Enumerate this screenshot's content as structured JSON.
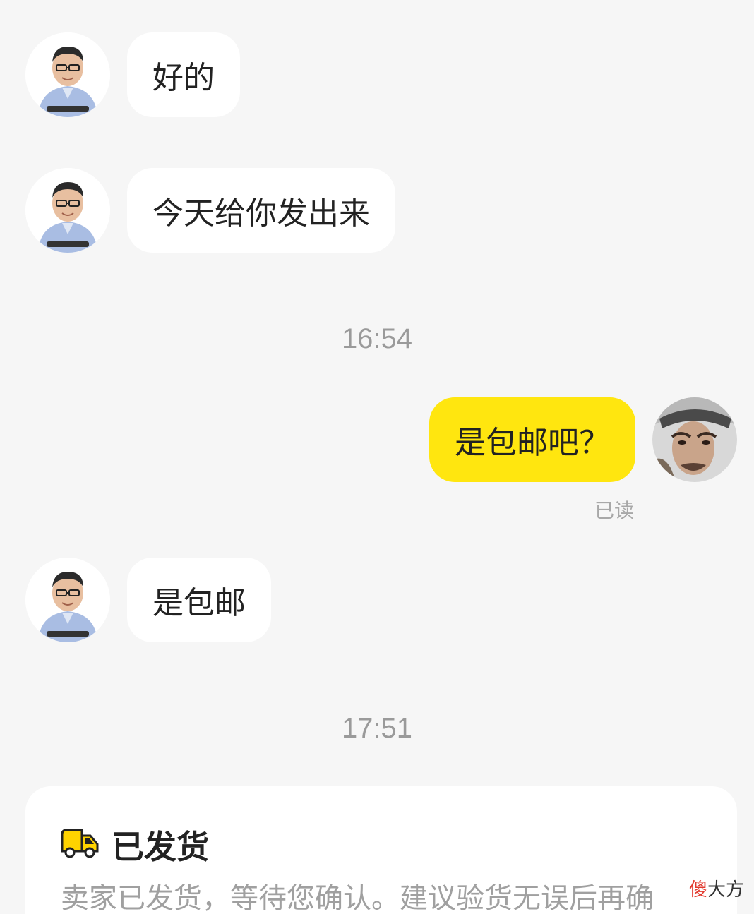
{
  "messages": [
    {
      "side": "left",
      "text": "好的",
      "avatar": "seller-avatar"
    },
    {
      "side": "left",
      "text": "今天给你发出来",
      "avatar": "seller-avatar"
    },
    {
      "side": "right",
      "text": "是包邮吧？",
      "avatar": "buyer-avatar",
      "status": "已读"
    },
    {
      "side": "left",
      "text": "是包邮",
      "avatar": "seller-avatar"
    }
  ],
  "timestamps": [
    "16:54",
    "17:51"
  ],
  "shipping_card": {
    "icon": "truck-icon",
    "title": "已发货",
    "description": "卖家已发货，等待您确认。建议验货无误后再确"
  },
  "watermark": {
    "accent": "傻",
    "rest": "大方"
  },
  "colors": {
    "background": "#f6f6f6",
    "incoming_bubble": "#ffffff",
    "outgoing_bubble": "#ffe60f",
    "accent_yellow": "#ffd300"
  }
}
